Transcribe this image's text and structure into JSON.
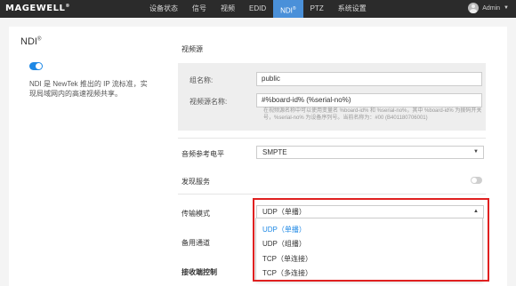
{
  "brand": {
    "logo": "MAGEWELL",
    "logo_mark": "®"
  },
  "nav": {
    "items": [
      {
        "label": "设备状态"
      },
      {
        "label": "信号"
      },
      {
        "label": "视频"
      },
      {
        "label": "EDID"
      },
      {
        "label": "NDI",
        "active": true
      },
      {
        "label": "PTZ"
      },
      {
        "label": "系统设置"
      }
    ],
    "reg_mark": "®"
  },
  "user": {
    "name": "Admin"
  },
  "left": {
    "title": "NDI",
    "title_mark": "®",
    "enabled": true,
    "description": "NDI 是 NewTek 推出的 IP 流标准，实现局域网内的高速视频共享。"
  },
  "video_source": {
    "section_title": "视频源",
    "group_name_label": "组名称:",
    "group_name_value": "public",
    "source_name_label": "视频源名称:",
    "source_name_value": "#%board-id% (%serial-no%)",
    "hint": "在视频源名称中可以使用变量名 %board-id% 和 %serial-no%，其中 %board-id% 为拨码开关号，%serial-no% 为设备序列号。当前名称为：#00 (B401180706001)"
  },
  "audio_ref": {
    "label": "音频参考电平",
    "value": "SMPTE"
  },
  "discovery": {
    "label": "发现服务",
    "enabled": false
  },
  "transport": {
    "label": "传输模式",
    "value": "UDP（单播）",
    "options": [
      "UDP（单播）",
      "UDP（组播）",
      "TCP（单连接）",
      "TCP（多连接）"
    ],
    "selected_index": 0
  },
  "backup_channel": {
    "label": "备用通道"
  },
  "receiver_control": {
    "label": "接收端控制"
  },
  "colors": {
    "accent": "#4a90d9",
    "toggle_on": "#1e88e5",
    "highlight": "#e02020"
  }
}
